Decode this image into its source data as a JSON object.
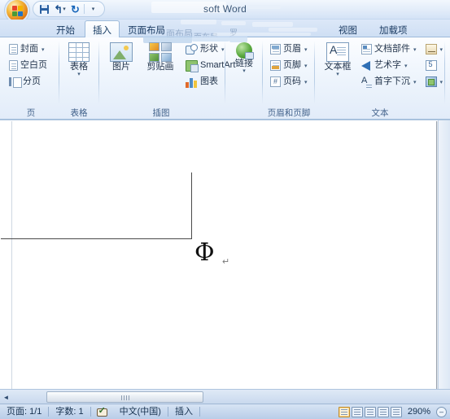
{
  "window": {
    "title": "soft Word",
    "quick_access": {
      "save_label": "保存",
      "undo_label": "撤销",
      "redo_label": "恢复",
      "customize_label": "自定义快速访问工具栏",
      "undo_glyph": "↰",
      "redo_glyph": "↻",
      "caret_glyph": "▾"
    },
    "office_button_label": "Office 按钮"
  },
  "tabs": [
    {
      "label": "开始",
      "active": false
    },
    {
      "label": "插入",
      "active": true
    },
    {
      "label": "页面布局",
      "active": false
    },
    {
      "label": "视图",
      "active": false
    },
    {
      "label": "加载项",
      "active": false
    }
  ],
  "ghost_tabs": [
    {
      "label": "面布局"
    },
    {
      "label": "面布局"
    },
    {
      "label": "罗"
    }
  ],
  "ribbon": {
    "groups": [
      {
        "name": "页",
        "label": "页",
        "items": [
          {
            "label": "封面",
            "icon": "cover-page-icon",
            "has_caret": true
          },
          {
            "label": "空白页",
            "icon": "blank-page-icon",
            "has_caret": false
          },
          {
            "label": "分页",
            "icon": "page-break-icon",
            "has_caret": false
          }
        ]
      },
      {
        "name": "表格",
        "label": "表格",
        "items": [
          {
            "label": "表格",
            "icon": "table-icon",
            "has_caret": true
          }
        ]
      },
      {
        "name": "插图",
        "label": "插图",
        "items": [
          {
            "label": "图片",
            "icon": "picture-icon",
            "has_caret": false
          },
          {
            "label": "剪贴画",
            "icon": "clip-art-icon",
            "has_caret": false
          },
          {
            "label": "形状",
            "icon": "shapes-icon",
            "has_caret": true
          },
          {
            "label": "SmartArt",
            "icon": "smartart-icon",
            "has_caret": false
          },
          {
            "label": "图表",
            "icon": "chart-icon",
            "has_caret": false
          }
        ]
      },
      {
        "name": "链接",
        "label": "",
        "items": [
          {
            "label": "链接",
            "icon": "hyperlink-icon",
            "has_caret": true
          }
        ]
      },
      {
        "name": "页眉和页脚",
        "label": "页眉和页脚",
        "items": [
          {
            "label": "页眉",
            "icon": "header-icon",
            "has_caret": true
          },
          {
            "label": "页脚",
            "icon": "footer-icon",
            "has_caret": true
          },
          {
            "label": "页码",
            "icon": "page-number-icon",
            "has_caret": true
          }
        ]
      },
      {
        "name": "文本",
        "label": "文本",
        "items": [
          {
            "label": "文本框",
            "icon": "text-box-icon",
            "has_caret": true
          },
          {
            "label": "文档部件",
            "icon": "quick-parts-icon",
            "has_caret": true
          },
          {
            "label": "艺术字",
            "icon": "wordart-icon",
            "has_caret": true
          },
          {
            "label": "首字下沉",
            "icon": "drop-cap-icon",
            "has_caret": true
          },
          {
            "label": "",
            "icon": "signature-line-icon",
            "has_caret": true
          },
          {
            "label": "",
            "icon": "date-time-icon",
            "has_caret": false
          },
          {
            "label": "",
            "icon": "object-icon",
            "has_caret": true
          }
        ]
      }
    ]
  },
  "document": {
    "character": "Φ",
    "pilcrow": "↵"
  },
  "scrollbar": {
    "left_arrow_glyph": "◄"
  },
  "statusbar": {
    "page": "页面: 1/1",
    "words": "字数: 1",
    "proofing_label": "校对",
    "language": "中文(中国)",
    "insert_mode": "插入",
    "views": [
      {
        "name": "print-layout",
        "selected": true
      },
      {
        "name": "full-screen-reading",
        "selected": false
      },
      {
        "name": "web-layout",
        "selected": false
      },
      {
        "name": "outline",
        "selected": false
      },
      {
        "name": "draft",
        "selected": false
      }
    ],
    "zoom": "290%",
    "zoom_out_glyph": "–"
  },
  "colors": {
    "accent": "#2a5fa0",
    "ribbon_bg": "#eaf1fb",
    "tab_active": "#fdfeff",
    "status_bg": "#b9cde8"
  }
}
